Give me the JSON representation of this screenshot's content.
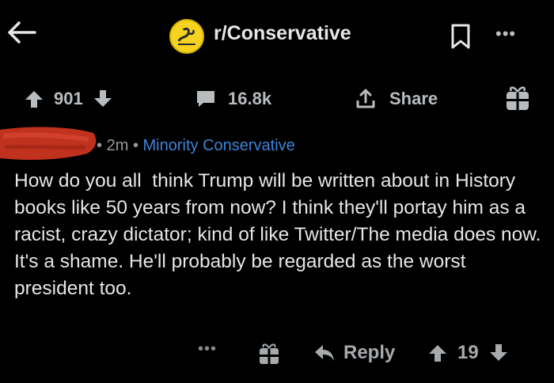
{
  "header": {
    "subreddit": "r/Conservative",
    "icon": "gadsden-flag-icon"
  },
  "post_actions": {
    "upvotes": "901",
    "comments": "16.8k",
    "share_label": "Share"
  },
  "comment": {
    "age": "2m",
    "separator": "•",
    "flair": "Minority Conservative",
    "text": "How do you all  think Trump will be written about in History books like 50 years from now? I think they'll portay him as a racist, crazy dictator; kind of like Twitter/The media does now. It's a shame. He'll probably be regarded as the worst president too.",
    "reply_label": "Reply",
    "votes": "19",
    "more": "•••"
  },
  "colors": {
    "background": "#000000",
    "flair": "#3f83d8",
    "redaction": "#c0311e",
    "subreddit_icon": "#f5d320"
  }
}
